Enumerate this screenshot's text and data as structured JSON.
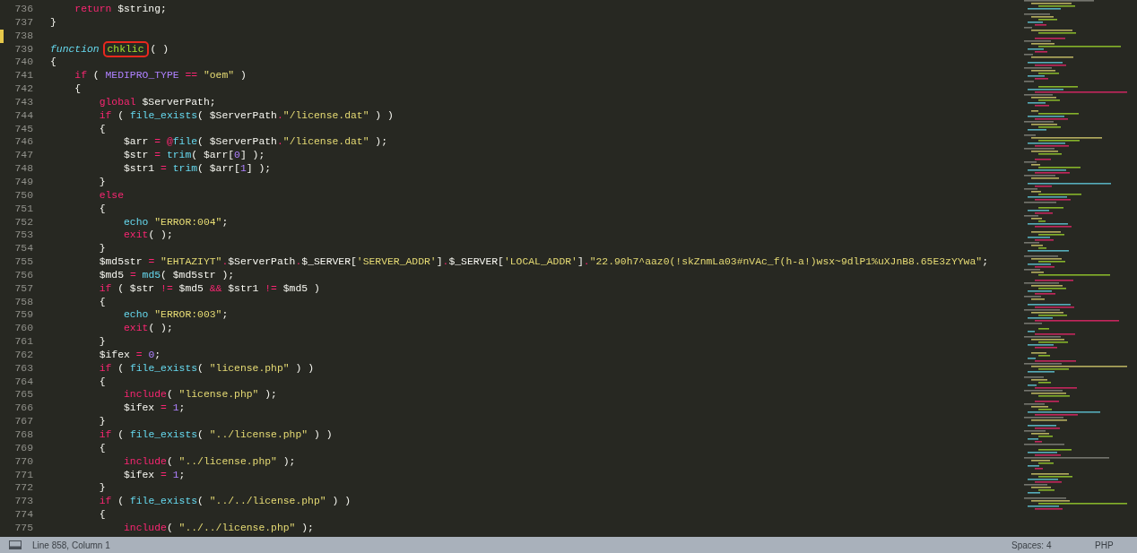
{
  "editor": {
    "lines": [
      {
        "number": "736",
        "modified": false,
        "tokens": [
          {
            "kind": "keyword",
            "text": "    return"
          },
          {
            "kind": "plain",
            "text": " $string;"
          }
        ]
      },
      {
        "number": "737",
        "modified": false,
        "tokens": [
          {
            "kind": "plain",
            "text": "}"
          }
        ]
      },
      {
        "number": "738",
        "modified": true
      },
      {
        "number": "739",
        "modified": false,
        "tokens": [
          {
            "kind": "storage",
            "text": "function "
          },
          {
            "kind": "fname",
            "text": "chklic",
            "boxed": true
          },
          {
            "kind": "plain",
            "text": "( )"
          }
        ]
      },
      {
        "number": "740",
        "modified": false,
        "tokens": [
          {
            "kind": "plain",
            "text": "{"
          }
        ]
      },
      {
        "number": "741",
        "modified": false,
        "tokens": [
          {
            "kind": "keyword",
            "text": "    if"
          },
          {
            "kind": "plain",
            "text": " ( "
          },
          {
            "kind": "constant",
            "text": "MEDIPRO_TYPE"
          },
          {
            "kind": "operator",
            "text": " == "
          },
          {
            "kind": "string",
            "text": "\"oem\""
          },
          {
            "kind": "plain",
            "text": " )"
          }
        ]
      },
      {
        "number": "742",
        "modified": false,
        "tokens": [
          {
            "kind": "plain",
            "text": "    {"
          }
        ]
      },
      {
        "number": "743",
        "modified": false,
        "tokens": [
          {
            "kind": "keyword",
            "text": "        global"
          },
          {
            "kind": "plain",
            "text": " $ServerPath;"
          }
        ]
      },
      {
        "number": "744",
        "modified": false,
        "tokens": [
          {
            "kind": "keyword",
            "text": "        if"
          },
          {
            "kind": "plain",
            "text": " ( "
          },
          {
            "kind": "builtin",
            "text": "file_exists"
          },
          {
            "kind": "plain",
            "text": "( $ServerPath"
          },
          {
            "kind": "operator",
            "text": "."
          },
          {
            "kind": "string",
            "text": "\"/license.dat\""
          },
          {
            "kind": "plain",
            "text": " ) )"
          }
        ]
      },
      {
        "number": "745",
        "modified": false,
        "tokens": [
          {
            "kind": "plain",
            "text": "        {"
          }
        ]
      },
      {
        "number": "746",
        "modified": false,
        "tokens": [
          {
            "kind": "plain",
            "text": "            $arr "
          },
          {
            "kind": "operator",
            "text": "= @"
          },
          {
            "kind": "builtin",
            "text": "file"
          },
          {
            "kind": "plain",
            "text": "( $ServerPath"
          },
          {
            "kind": "operator",
            "text": "."
          },
          {
            "kind": "string",
            "text": "\"/license.dat\""
          },
          {
            "kind": "plain",
            "text": " );"
          }
        ]
      },
      {
        "number": "747",
        "modified": false,
        "tokens": [
          {
            "kind": "plain",
            "text": "            $str "
          },
          {
            "kind": "operator",
            "text": "= "
          },
          {
            "kind": "builtin",
            "text": "trim"
          },
          {
            "kind": "plain",
            "text": "( $arr["
          },
          {
            "kind": "constant",
            "text": "0"
          },
          {
            "kind": "plain",
            "text": "] );"
          }
        ]
      },
      {
        "number": "748",
        "modified": false,
        "tokens": [
          {
            "kind": "plain",
            "text": "            $str1 "
          },
          {
            "kind": "operator",
            "text": "= "
          },
          {
            "kind": "builtin",
            "text": "trim"
          },
          {
            "kind": "plain",
            "text": "( $arr["
          },
          {
            "kind": "constant",
            "text": "1"
          },
          {
            "kind": "plain",
            "text": "] );"
          }
        ]
      },
      {
        "number": "749",
        "modified": false,
        "tokens": [
          {
            "kind": "plain",
            "text": "        }"
          }
        ]
      },
      {
        "number": "750",
        "modified": false,
        "tokens": [
          {
            "kind": "keyword",
            "text": "        else"
          }
        ]
      },
      {
        "number": "751",
        "modified": false,
        "tokens": [
          {
            "kind": "plain",
            "text": "        {"
          }
        ]
      },
      {
        "number": "752",
        "modified": false,
        "tokens": [
          {
            "kind": "builtin",
            "text": "            echo "
          },
          {
            "kind": "string",
            "text": "\"ERROR:004\""
          },
          {
            "kind": "plain",
            "text": ";"
          }
        ]
      },
      {
        "number": "753",
        "modified": false,
        "tokens": [
          {
            "kind": "keyword",
            "text": "            exit"
          },
          {
            "kind": "plain",
            "text": "( );"
          }
        ]
      },
      {
        "number": "754",
        "modified": false,
        "tokens": [
          {
            "kind": "plain",
            "text": "        }"
          }
        ]
      },
      {
        "number": "755",
        "modified": false,
        "tokens": [
          {
            "kind": "plain",
            "text": "        $md5str "
          },
          {
            "kind": "operator",
            "text": "= "
          },
          {
            "kind": "string",
            "text": "\"EHTAZIYT\""
          },
          {
            "kind": "operator",
            "text": "."
          },
          {
            "kind": "plain",
            "text": "$ServerPath"
          },
          {
            "kind": "operator",
            "text": "."
          },
          {
            "kind": "plain",
            "text": "$_SERVER["
          },
          {
            "kind": "string",
            "text": "'SERVER_ADDR'"
          },
          {
            "kind": "plain",
            "text": "]"
          },
          {
            "kind": "operator",
            "text": "."
          },
          {
            "kind": "plain",
            "text": "$_SERVER["
          },
          {
            "kind": "string",
            "text": "'LOCAL_ADDR'"
          },
          {
            "kind": "plain",
            "text": "]"
          },
          {
            "kind": "operator",
            "text": "."
          },
          {
            "kind": "string",
            "text": "\"22.90h7^aaz0(!skZnmLa03#nVAc_f(h-a!)wsx~9dlP1%uXJnB8.65E3zYYwa\""
          },
          {
            "kind": "plain",
            "text": ";"
          }
        ]
      },
      {
        "number": "756",
        "modified": false,
        "tokens": [
          {
            "kind": "plain",
            "text": "        $md5 "
          },
          {
            "kind": "operator",
            "text": "= "
          },
          {
            "kind": "builtin",
            "text": "md5"
          },
          {
            "kind": "plain",
            "text": "( $md5str );"
          }
        ]
      },
      {
        "number": "757",
        "modified": false,
        "tokens": [
          {
            "kind": "keyword",
            "text": "        if"
          },
          {
            "kind": "plain",
            "text": " ( $str "
          },
          {
            "kind": "operator",
            "text": "!="
          },
          {
            "kind": "plain",
            "text": " $md5 "
          },
          {
            "kind": "operator",
            "text": "&&"
          },
          {
            "kind": "plain",
            "text": " $str1 "
          },
          {
            "kind": "operator",
            "text": "!="
          },
          {
            "kind": "plain",
            "text": " $md5 )"
          }
        ]
      },
      {
        "number": "758",
        "modified": false,
        "tokens": [
          {
            "kind": "plain",
            "text": "        {"
          }
        ]
      },
      {
        "number": "759",
        "modified": false,
        "tokens": [
          {
            "kind": "builtin",
            "text": "            echo "
          },
          {
            "kind": "string",
            "text": "\"ERROR:003\""
          },
          {
            "kind": "plain",
            "text": ";"
          }
        ]
      },
      {
        "number": "760",
        "modified": false,
        "tokens": [
          {
            "kind": "keyword",
            "text": "            exit"
          },
          {
            "kind": "plain",
            "text": "( );"
          }
        ]
      },
      {
        "number": "761",
        "modified": false,
        "tokens": [
          {
            "kind": "plain",
            "text": "        }"
          }
        ]
      },
      {
        "number": "762",
        "modified": false,
        "tokens": [
          {
            "kind": "plain",
            "text": "        $ifex "
          },
          {
            "kind": "operator",
            "text": "= "
          },
          {
            "kind": "constant",
            "text": "0"
          },
          {
            "kind": "plain",
            "text": ";"
          }
        ]
      },
      {
        "number": "763",
        "modified": false,
        "tokens": [
          {
            "kind": "keyword",
            "text": "        if"
          },
          {
            "kind": "plain",
            "text": " ( "
          },
          {
            "kind": "builtin",
            "text": "file_exists"
          },
          {
            "kind": "plain",
            "text": "( "
          },
          {
            "kind": "string",
            "text": "\"license.php\""
          },
          {
            "kind": "plain",
            "text": " ) )"
          }
        ]
      },
      {
        "number": "764",
        "modified": false,
        "tokens": [
          {
            "kind": "plain",
            "text": "        {"
          }
        ]
      },
      {
        "number": "765",
        "modified": false,
        "tokens": [
          {
            "kind": "keyword",
            "text": "            include"
          },
          {
            "kind": "plain",
            "text": "( "
          },
          {
            "kind": "string",
            "text": "\"license.php\""
          },
          {
            "kind": "plain",
            "text": " );"
          }
        ]
      },
      {
        "number": "766",
        "modified": false,
        "tokens": [
          {
            "kind": "plain",
            "text": "            $ifex "
          },
          {
            "kind": "operator",
            "text": "= "
          },
          {
            "kind": "constant",
            "text": "1"
          },
          {
            "kind": "plain",
            "text": ";"
          }
        ]
      },
      {
        "number": "767",
        "modified": false,
        "tokens": [
          {
            "kind": "plain",
            "text": "        }"
          }
        ]
      },
      {
        "number": "768",
        "modified": false,
        "tokens": [
          {
            "kind": "keyword",
            "text": "        if"
          },
          {
            "kind": "plain",
            "text": " ( "
          },
          {
            "kind": "builtin",
            "text": "file_exists"
          },
          {
            "kind": "plain",
            "text": "( "
          },
          {
            "kind": "string",
            "text": "\"../license.php\""
          },
          {
            "kind": "plain",
            "text": " ) )"
          }
        ]
      },
      {
        "number": "769",
        "modified": false,
        "tokens": [
          {
            "kind": "plain",
            "text": "        {"
          }
        ]
      },
      {
        "number": "770",
        "modified": false,
        "tokens": [
          {
            "kind": "keyword",
            "text": "            include"
          },
          {
            "kind": "plain",
            "text": "( "
          },
          {
            "kind": "string",
            "text": "\"../license.php\""
          },
          {
            "kind": "plain",
            "text": " );"
          }
        ]
      },
      {
        "number": "771",
        "modified": false,
        "tokens": [
          {
            "kind": "plain",
            "text": "            $ifex "
          },
          {
            "kind": "operator",
            "text": "= "
          },
          {
            "kind": "constant",
            "text": "1"
          },
          {
            "kind": "plain",
            "text": ";"
          }
        ]
      },
      {
        "number": "772",
        "modified": false,
        "tokens": [
          {
            "kind": "plain",
            "text": "        }"
          }
        ]
      },
      {
        "number": "773",
        "modified": false,
        "tokens": [
          {
            "kind": "keyword",
            "text": "        if"
          },
          {
            "kind": "plain",
            "text": " ( "
          },
          {
            "kind": "builtin",
            "text": "file_exists"
          },
          {
            "kind": "plain",
            "text": "( "
          },
          {
            "kind": "string",
            "text": "\"../../license.php\""
          },
          {
            "kind": "plain",
            "text": " ) )"
          }
        ]
      },
      {
        "number": "774",
        "modified": false,
        "tokens": [
          {
            "kind": "plain",
            "text": "        {"
          }
        ]
      },
      {
        "number": "775",
        "modified": false,
        "tokens": [
          {
            "kind": "keyword",
            "text": "            include"
          },
          {
            "kind": "plain",
            "text": "( "
          },
          {
            "kind": "string",
            "text": "\"../../license.php\""
          },
          {
            "kind": "plain",
            "text": " );"
          }
        ]
      }
    ]
  },
  "status_bar": {
    "position": "Line 858, Column 1",
    "indentation": "Spaces: 4",
    "syntax": "PHP"
  }
}
